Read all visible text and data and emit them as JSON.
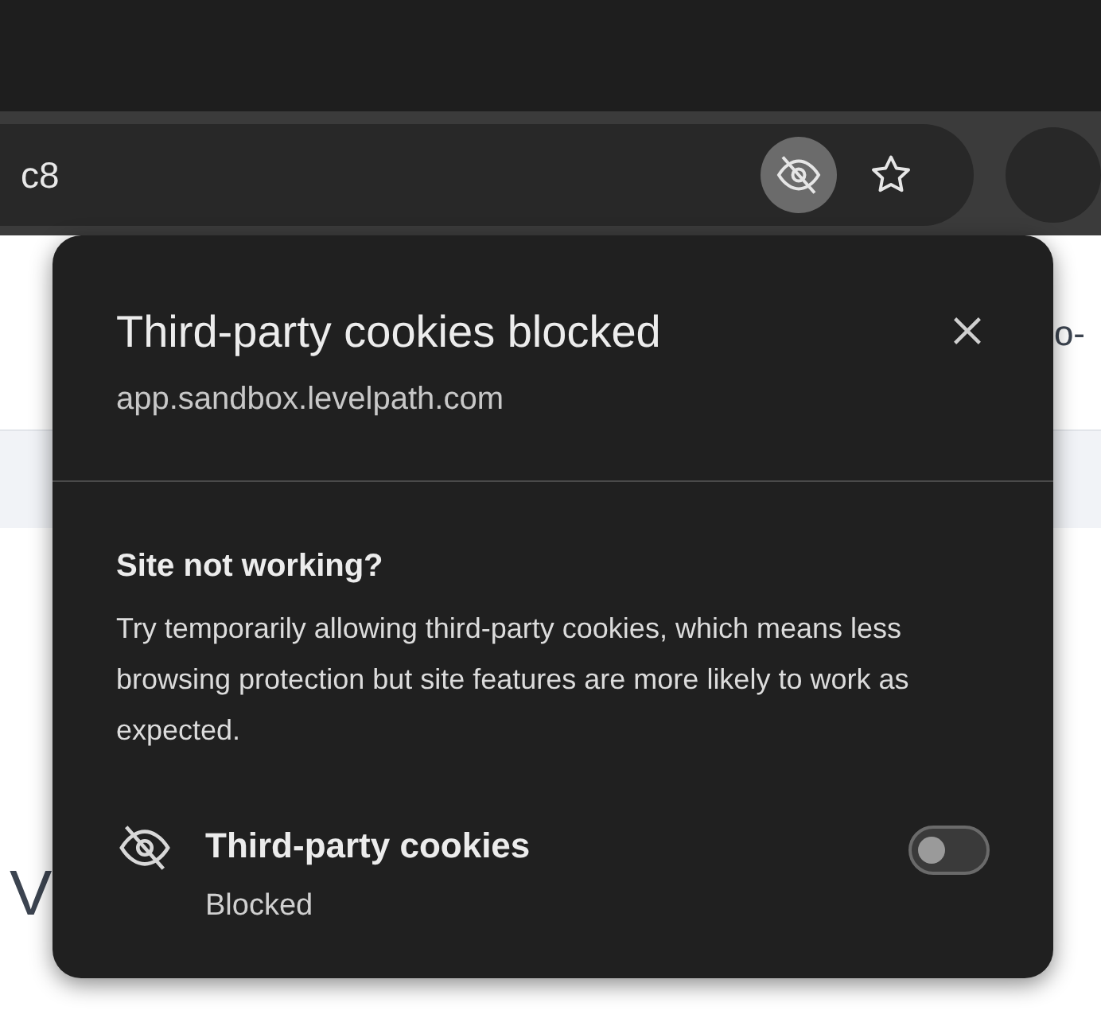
{
  "address_bar": {
    "url": "c8"
  },
  "page": {
    "side_text": "o-",
    "heading_text": "V"
  },
  "popup": {
    "title": "Third-party cookies blocked",
    "site": "app.sandbox.levelpath.com",
    "section_title": "Site not working?",
    "section_body": "Try temporarily allowing third-party cookies, which means less browsing protection but site features are more likely to work as expected.",
    "setting": {
      "label": "Third-party cookies",
      "status": "Blocked",
      "on": false
    }
  }
}
